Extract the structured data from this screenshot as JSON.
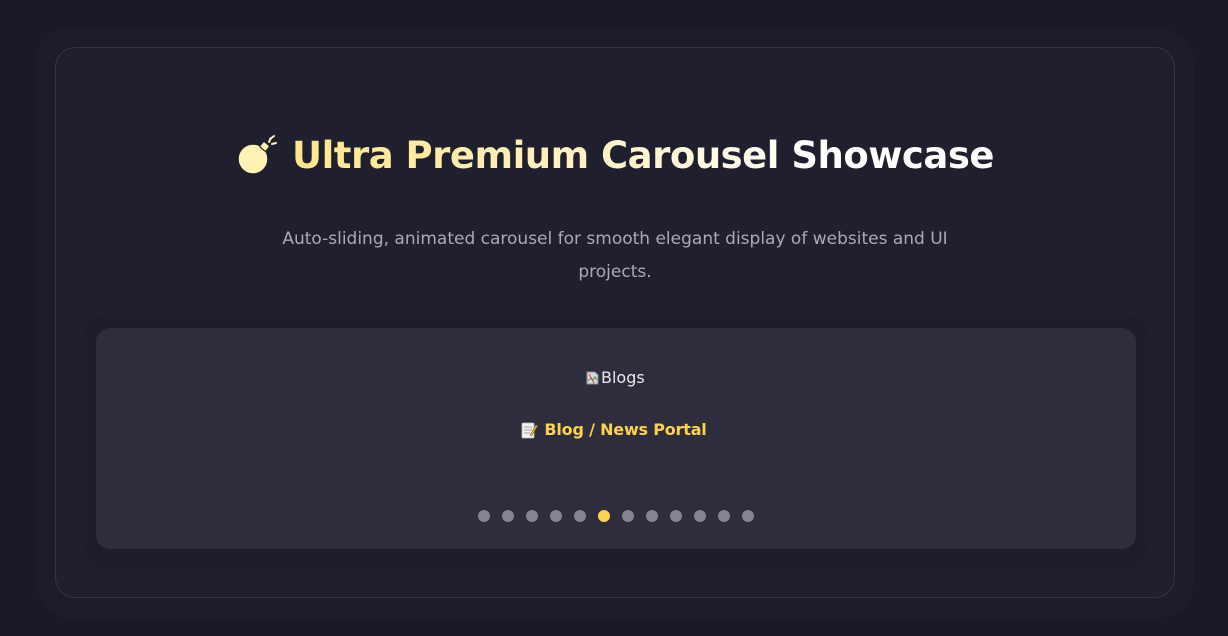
{
  "header": {
    "title": "Ultra Premium Carousel Showcase",
    "title_icon": "bomb-icon",
    "subtitle": "Auto-sliding, animated carousel for smooth elegant display of websites and UI projects."
  },
  "carousel": {
    "slide": {
      "image_alt": "Blogs",
      "caption_icon": "memo-icon",
      "caption": "Blog / News Portal"
    },
    "dot_count": 12,
    "active_index": 5
  },
  "colors": {
    "background": "#191927",
    "panel": "#1f1f2e",
    "carousel": "#2d2d3b",
    "accent": "#fcd34d",
    "dot_inactive": "#85858f"
  }
}
